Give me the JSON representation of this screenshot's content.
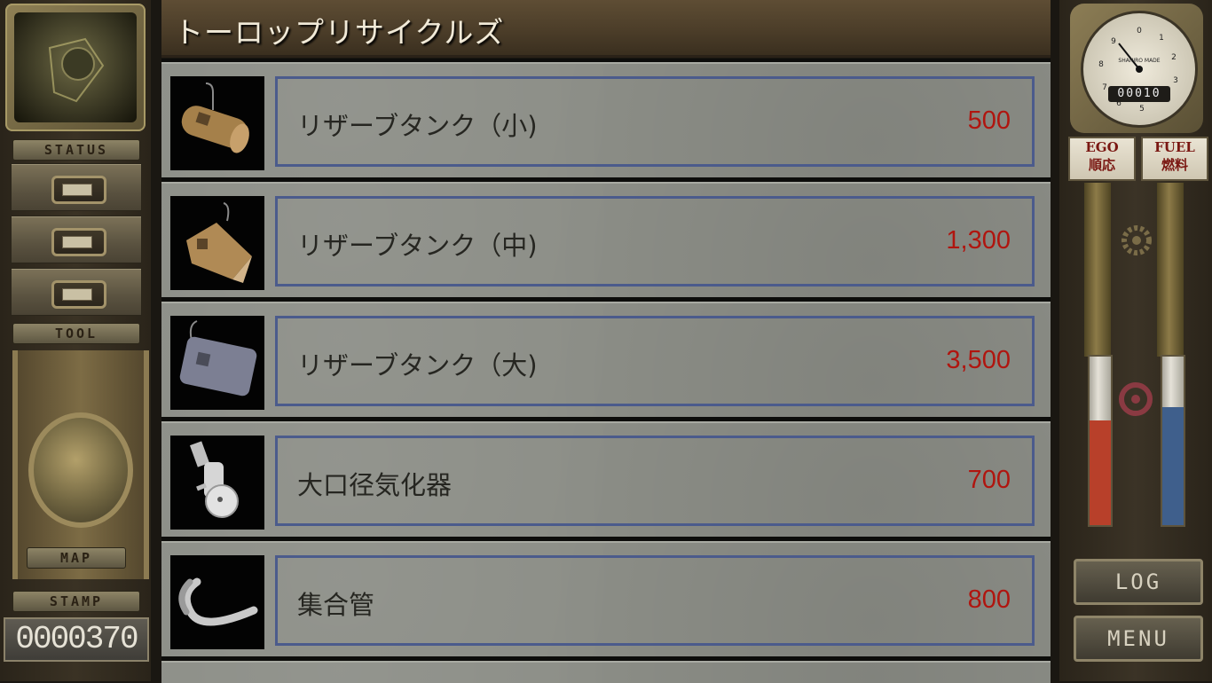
{
  "shop": {
    "title": "トーロップリサイクルズ",
    "items": [
      {
        "name": "リザーブタンク（小)",
        "price": "500",
        "icon": "small-tank-icon"
      },
      {
        "name": "リザーブタンク（中)",
        "price": "1,300",
        "icon": "medium-tank-icon"
      },
      {
        "name": "リザーブタンク（大)",
        "price": "3,500",
        "icon": "large-tank-icon"
      },
      {
        "name": "大口径気化器",
        "price": "700",
        "icon": "carburetor-icon"
      },
      {
        "name": "集合管",
        "price": "800",
        "icon": "exhaust-pipe-icon"
      }
    ]
  },
  "left_panel": {
    "status_label": "STATUS",
    "tool_label": "TOOL",
    "map_label": "MAP",
    "stamp_label": "STAMP",
    "stamp_count": "0000370"
  },
  "right_panel": {
    "gauge_brand": "SHANIRO MADE",
    "odometer": "00010",
    "ego_label_en": "EGO",
    "ego_label_jp": "順応",
    "fuel_label_en": "FUEL",
    "fuel_label_jp": "燃料",
    "ego_level": 0.62,
    "fuel_level": 0.7,
    "ego_color": "#b8402a",
    "fuel_color": "#3f5f8c",
    "log_button": "LOG",
    "menu_button": "MENU"
  },
  "colors": {
    "price": "#b0150f",
    "entry_border": "#4b5b8c",
    "row_background": "#8c8e87"
  }
}
